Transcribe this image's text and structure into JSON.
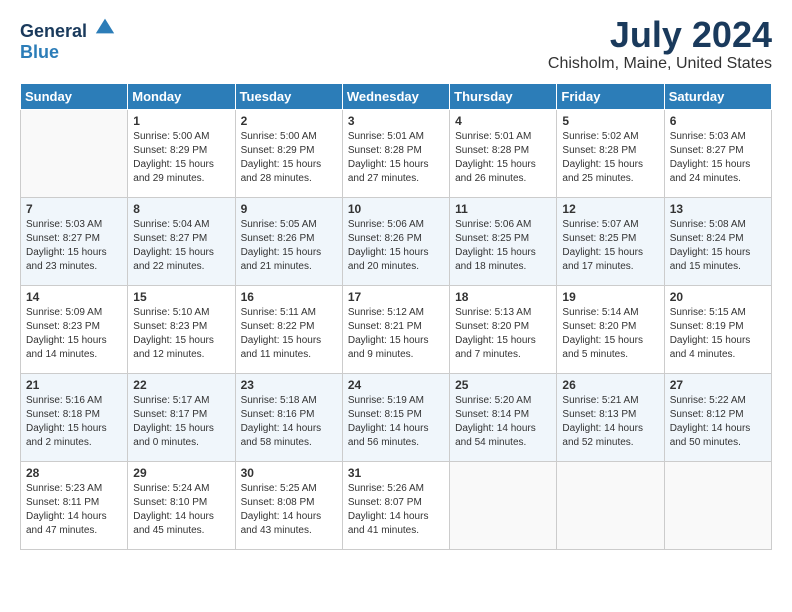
{
  "header": {
    "logo_general": "General",
    "logo_blue": "Blue",
    "month_year": "July 2024",
    "location": "Chisholm, Maine, United States"
  },
  "weekdays": [
    "Sunday",
    "Monday",
    "Tuesday",
    "Wednesday",
    "Thursday",
    "Friday",
    "Saturday"
  ],
  "weeks": [
    [
      {
        "day": "",
        "sunrise": "",
        "sunset": "",
        "daylight": ""
      },
      {
        "day": "1",
        "sunrise": "Sunrise: 5:00 AM",
        "sunset": "Sunset: 8:29 PM",
        "daylight": "Daylight: 15 hours and 29 minutes."
      },
      {
        "day": "2",
        "sunrise": "Sunrise: 5:00 AM",
        "sunset": "Sunset: 8:29 PM",
        "daylight": "Daylight: 15 hours and 28 minutes."
      },
      {
        "day": "3",
        "sunrise": "Sunrise: 5:01 AM",
        "sunset": "Sunset: 8:28 PM",
        "daylight": "Daylight: 15 hours and 27 minutes."
      },
      {
        "day": "4",
        "sunrise": "Sunrise: 5:01 AM",
        "sunset": "Sunset: 8:28 PM",
        "daylight": "Daylight: 15 hours and 26 minutes."
      },
      {
        "day": "5",
        "sunrise": "Sunrise: 5:02 AM",
        "sunset": "Sunset: 8:28 PM",
        "daylight": "Daylight: 15 hours and 25 minutes."
      },
      {
        "day": "6",
        "sunrise": "Sunrise: 5:03 AM",
        "sunset": "Sunset: 8:27 PM",
        "daylight": "Daylight: 15 hours and 24 minutes."
      }
    ],
    [
      {
        "day": "7",
        "sunrise": "Sunrise: 5:03 AM",
        "sunset": "Sunset: 8:27 PM",
        "daylight": "Daylight: 15 hours and 23 minutes."
      },
      {
        "day": "8",
        "sunrise": "Sunrise: 5:04 AM",
        "sunset": "Sunset: 8:27 PM",
        "daylight": "Daylight: 15 hours and 22 minutes."
      },
      {
        "day": "9",
        "sunrise": "Sunrise: 5:05 AM",
        "sunset": "Sunset: 8:26 PM",
        "daylight": "Daylight: 15 hours and 21 minutes."
      },
      {
        "day": "10",
        "sunrise": "Sunrise: 5:06 AM",
        "sunset": "Sunset: 8:26 PM",
        "daylight": "Daylight: 15 hours and 20 minutes."
      },
      {
        "day": "11",
        "sunrise": "Sunrise: 5:06 AM",
        "sunset": "Sunset: 8:25 PM",
        "daylight": "Daylight: 15 hours and 18 minutes."
      },
      {
        "day": "12",
        "sunrise": "Sunrise: 5:07 AM",
        "sunset": "Sunset: 8:25 PM",
        "daylight": "Daylight: 15 hours and 17 minutes."
      },
      {
        "day": "13",
        "sunrise": "Sunrise: 5:08 AM",
        "sunset": "Sunset: 8:24 PM",
        "daylight": "Daylight: 15 hours and 15 minutes."
      }
    ],
    [
      {
        "day": "14",
        "sunrise": "Sunrise: 5:09 AM",
        "sunset": "Sunset: 8:23 PM",
        "daylight": "Daylight: 15 hours and 14 minutes."
      },
      {
        "day": "15",
        "sunrise": "Sunrise: 5:10 AM",
        "sunset": "Sunset: 8:23 PM",
        "daylight": "Daylight: 15 hours and 12 minutes."
      },
      {
        "day": "16",
        "sunrise": "Sunrise: 5:11 AM",
        "sunset": "Sunset: 8:22 PM",
        "daylight": "Daylight: 15 hours and 11 minutes."
      },
      {
        "day": "17",
        "sunrise": "Sunrise: 5:12 AM",
        "sunset": "Sunset: 8:21 PM",
        "daylight": "Daylight: 15 hours and 9 minutes."
      },
      {
        "day": "18",
        "sunrise": "Sunrise: 5:13 AM",
        "sunset": "Sunset: 8:20 PM",
        "daylight": "Daylight: 15 hours and 7 minutes."
      },
      {
        "day": "19",
        "sunrise": "Sunrise: 5:14 AM",
        "sunset": "Sunset: 8:20 PM",
        "daylight": "Daylight: 15 hours and 5 minutes."
      },
      {
        "day": "20",
        "sunrise": "Sunrise: 5:15 AM",
        "sunset": "Sunset: 8:19 PM",
        "daylight": "Daylight: 15 hours and 4 minutes."
      }
    ],
    [
      {
        "day": "21",
        "sunrise": "Sunrise: 5:16 AM",
        "sunset": "Sunset: 8:18 PM",
        "daylight": "Daylight: 15 hours and 2 minutes."
      },
      {
        "day": "22",
        "sunrise": "Sunrise: 5:17 AM",
        "sunset": "Sunset: 8:17 PM",
        "daylight": "Daylight: 15 hours and 0 minutes."
      },
      {
        "day": "23",
        "sunrise": "Sunrise: 5:18 AM",
        "sunset": "Sunset: 8:16 PM",
        "daylight": "Daylight: 14 hours and 58 minutes."
      },
      {
        "day": "24",
        "sunrise": "Sunrise: 5:19 AM",
        "sunset": "Sunset: 8:15 PM",
        "daylight": "Daylight: 14 hours and 56 minutes."
      },
      {
        "day": "25",
        "sunrise": "Sunrise: 5:20 AM",
        "sunset": "Sunset: 8:14 PM",
        "daylight": "Daylight: 14 hours and 54 minutes."
      },
      {
        "day": "26",
        "sunrise": "Sunrise: 5:21 AM",
        "sunset": "Sunset: 8:13 PM",
        "daylight": "Daylight: 14 hours and 52 minutes."
      },
      {
        "day": "27",
        "sunrise": "Sunrise: 5:22 AM",
        "sunset": "Sunset: 8:12 PM",
        "daylight": "Daylight: 14 hours and 50 minutes."
      }
    ],
    [
      {
        "day": "28",
        "sunrise": "Sunrise: 5:23 AM",
        "sunset": "Sunset: 8:11 PM",
        "daylight": "Daylight: 14 hours and 47 minutes."
      },
      {
        "day": "29",
        "sunrise": "Sunrise: 5:24 AM",
        "sunset": "Sunset: 8:10 PM",
        "daylight": "Daylight: 14 hours and 45 minutes."
      },
      {
        "day": "30",
        "sunrise": "Sunrise: 5:25 AM",
        "sunset": "Sunset: 8:08 PM",
        "daylight": "Daylight: 14 hours and 43 minutes."
      },
      {
        "day": "31",
        "sunrise": "Sunrise: 5:26 AM",
        "sunset": "Sunset: 8:07 PM",
        "daylight": "Daylight: 14 hours and 41 minutes."
      },
      {
        "day": "",
        "sunrise": "",
        "sunset": "",
        "daylight": ""
      },
      {
        "day": "",
        "sunrise": "",
        "sunset": "",
        "daylight": ""
      },
      {
        "day": "",
        "sunrise": "",
        "sunset": "",
        "daylight": ""
      }
    ]
  ]
}
